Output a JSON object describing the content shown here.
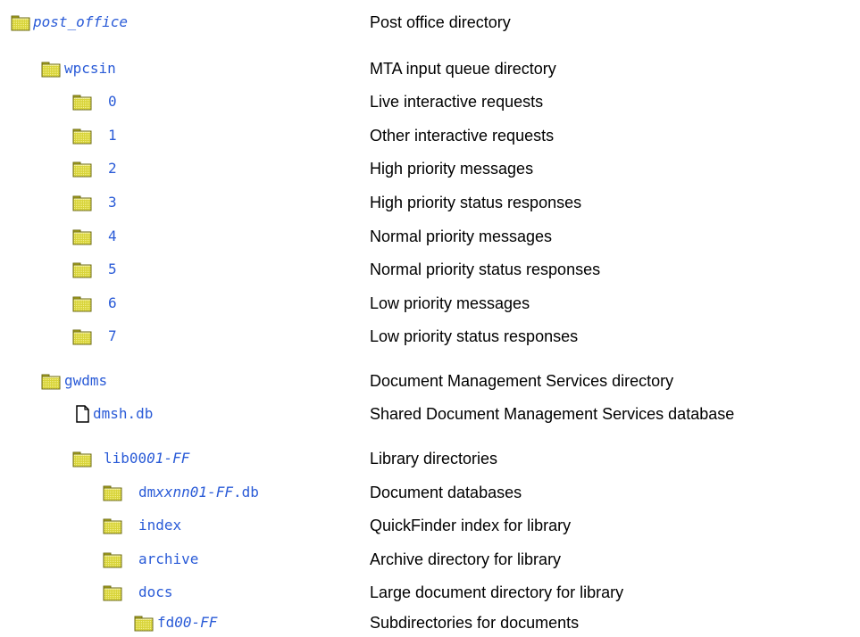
{
  "colors": {
    "link": "#2a5bd7",
    "folder_fill": "#d8d43a",
    "folder_dark": "#6b6a10",
    "text": "#000000"
  },
  "rows": [
    {
      "icon": "folder-icon",
      "name": [
        {
          "t": "post_office",
          "i": true
        }
      ],
      "desc": "Post office directory"
    },
    {
      "icon": "folder-icon",
      "name": [
        {
          "t": "wpcsin"
        }
      ],
      "desc": "MTA input queue directory"
    },
    {
      "icon": "folder-icon",
      "name": [
        {
          "t": "0"
        }
      ],
      "desc": "Live interactive requests"
    },
    {
      "icon": "folder-icon",
      "name": [
        {
          "t": "1"
        }
      ],
      "desc": "Other interactive requests"
    },
    {
      "icon": "folder-icon",
      "name": [
        {
          "t": "2"
        }
      ],
      "desc": "High priority messages"
    },
    {
      "icon": "folder-icon",
      "name": [
        {
          "t": "3"
        }
      ],
      "desc": "High priority status responses"
    },
    {
      "icon": "folder-icon",
      "name": [
        {
          "t": "4"
        }
      ],
      "desc": "Normal priority messages"
    },
    {
      "icon": "folder-icon",
      "name": [
        {
          "t": "5"
        }
      ],
      "desc": "Normal priority status responses"
    },
    {
      "icon": "folder-icon",
      "name": [
        {
          "t": "6"
        }
      ],
      "desc": "Low priority messages"
    },
    {
      "icon": "folder-icon",
      "name": [
        {
          "t": "7"
        }
      ],
      "desc": "Low priority status responses"
    },
    {
      "icon": "folder-icon",
      "name": [
        {
          "t": "gwdms"
        }
      ],
      "desc": "Document Management Services directory"
    },
    {
      "icon": "file-icon",
      "name": [
        {
          "t": "dmsh.db"
        }
      ],
      "desc": "Shared Document Management Services database"
    },
    {
      "icon": "folder-icon",
      "name": [
        {
          "t": "lib00"
        },
        {
          "t": "01-FF",
          "i": true
        }
      ],
      "desc": "Library directories"
    },
    {
      "icon": "folder-icon",
      "name": [
        {
          "t": "dm"
        },
        {
          "t": "xxnn01-FF",
          "i": true
        },
        {
          "t": ".db"
        }
      ],
      "desc": "Document databases"
    },
    {
      "icon": "folder-icon",
      "name": [
        {
          "t": "index"
        }
      ],
      "desc": "QuickFinder index for library"
    },
    {
      "icon": "folder-icon",
      "name": [
        {
          "t": "archive"
        }
      ],
      "desc": "Archive directory for library"
    },
    {
      "icon": "folder-icon",
      "name": [
        {
          "t": "docs"
        }
      ],
      "desc": "Large document directory for library"
    },
    {
      "icon": "folder-icon",
      "name": [
        {
          "t": "fd"
        },
        {
          "t": "00-FF",
          "i": true
        }
      ],
      "desc": "Subdirectories for documents"
    }
  ]
}
